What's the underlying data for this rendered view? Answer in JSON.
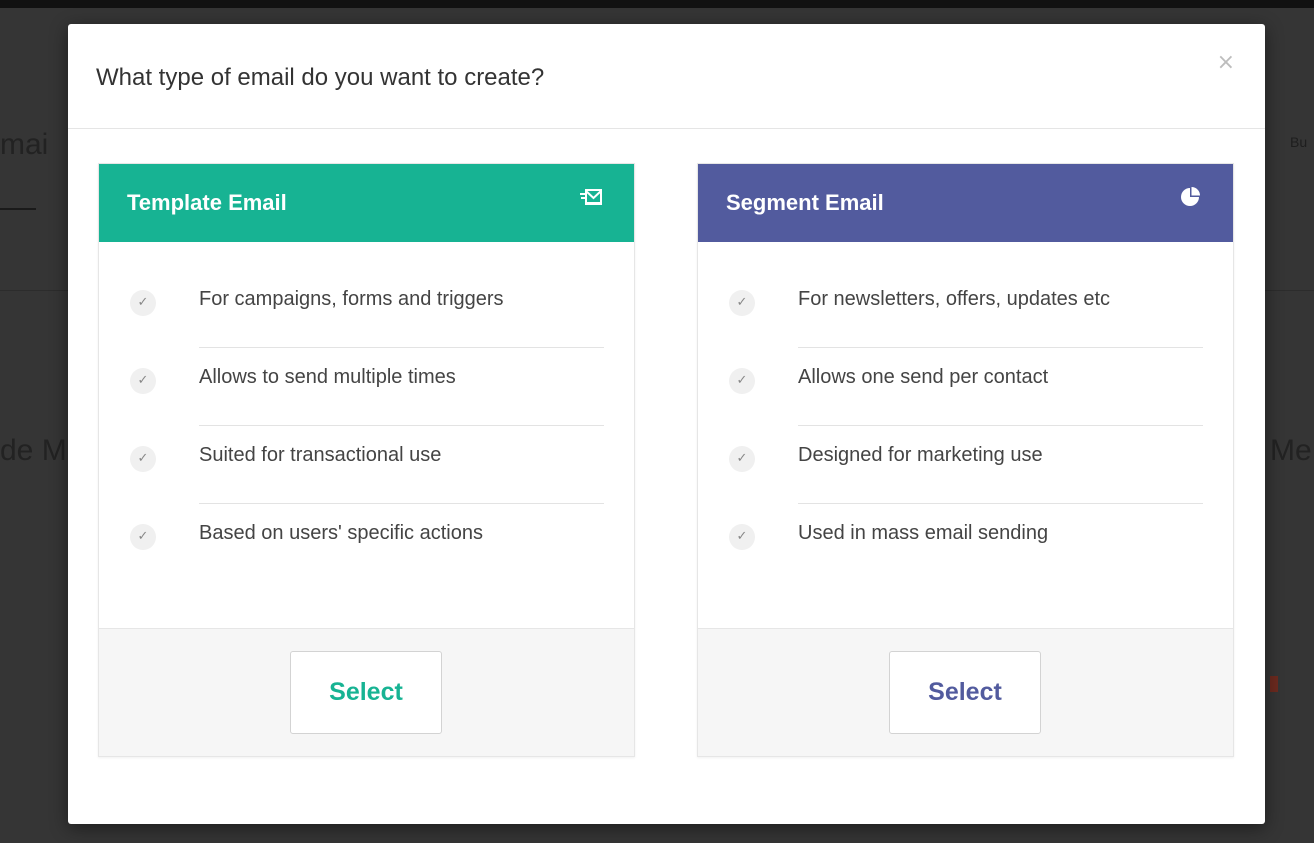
{
  "background": {
    "fragments": [
      "mai",
      "de M",
      "Me",
      "Bu"
    ]
  },
  "modal": {
    "title": "What type of email do you want to create?",
    "close_label": "×"
  },
  "cards": [
    {
      "id": "template",
      "title": "Template Email",
      "icon": "send-email-icon",
      "color": "#17b393",
      "features": [
        "For campaigns, forms and triggers",
        "Allows to send multiple times",
        "Suited for transactional use",
        "Based on users' specific actions"
      ],
      "button_label": "Select"
    },
    {
      "id": "segment",
      "title": "Segment Email",
      "icon": "pie-chart-icon",
      "color": "#525b9e",
      "features": [
        "For newsletters, offers, updates etc",
        "Allows one send per contact",
        "Designed for marketing use",
        "Used in mass email sending"
      ],
      "button_label": "Select"
    }
  ]
}
